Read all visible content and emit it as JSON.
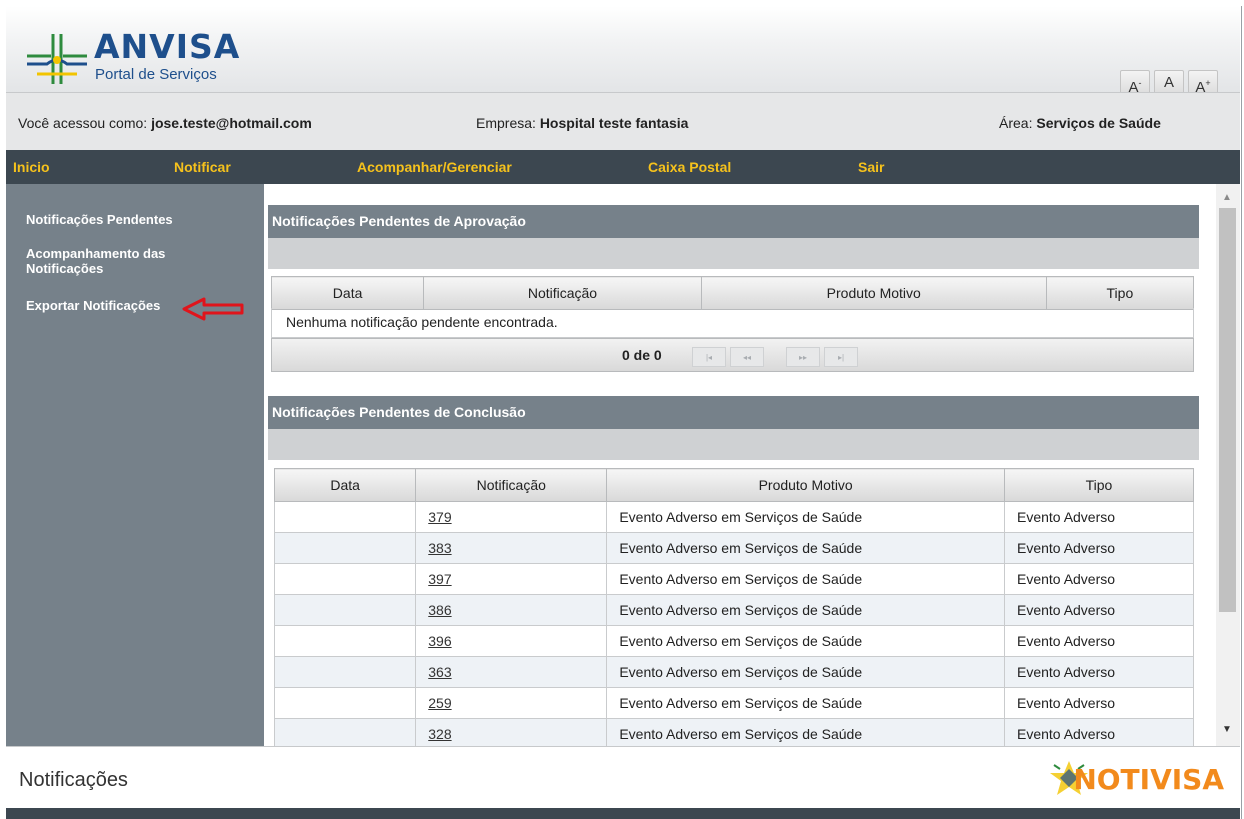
{
  "header": {
    "brand_title": "ANVISA",
    "brand_subtitle": "Portal de Serviços",
    "font_controls": [
      "A",
      "A",
      "A"
    ],
    "font_controls_sup": [
      "-",
      "",
      "+"
    ]
  },
  "user_info": {
    "user_label": "Você acessou como:",
    "user_value": "jose.teste@hotmail.com",
    "company_label": "Empresa:",
    "company_value": "Hospital teste fantasia",
    "area_label": "Área:",
    "area_value": "Serviços de Saúde"
  },
  "menu": {
    "items": [
      "Inicio",
      "Notificar",
      "Acompanhar/Gerenciar",
      "Caixa Postal",
      "Sair"
    ]
  },
  "sidebar": {
    "items": [
      "Notificações Pendentes",
      "Acompanhamento das Notificações",
      "Exportar Notificações"
    ]
  },
  "approval": {
    "title": "Notificações Pendentes de Aprovação",
    "columns": [
      "Data",
      "Notificação",
      "Produto Motivo",
      "Tipo"
    ],
    "empty_message": "Nenhuma notificação pendente encontrada.",
    "pager_count": "0 de 0",
    "pager_buttons": [
      "|◂",
      "◂◂",
      "▸▸",
      "▸|"
    ]
  },
  "conclusion": {
    "title": "Notificações Pendentes de Conclusão",
    "columns": [
      "Data",
      "Notificação",
      "Produto Motivo",
      "Tipo"
    ],
    "rows": [
      {
        "data": "",
        "notificacao": "379",
        "produto_motivo": "Evento Adverso em Serviços de Saúde",
        "tipo": "Evento Adverso"
      },
      {
        "data": "",
        "notificacao": "383",
        "produto_motivo": "Evento Adverso em Serviços de Saúde",
        "tipo": "Evento Adverso"
      },
      {
        "data": "",
        "notificacao": "397",
        "produto_motivo": "Evento Adverso em Serviços de Saúde",
        "tipo": "Evento Adverso"
      },
      {
        "data": "",
        "notificacao": "386",
        "produto_motivo": "Evento Adverso em Serviços de Saúde",
        "tipo": "Evento Adverso"
      },
      {
        "data": "",
        "notificacao": "396",
        "produto_motivo": "Evento Adverso em Serviços de Saúde",
        "tipo": "Evento Adverso"
      },
      {
        "data": "",
        "notificacao": "363",
        "produto_motivo": "Evento Adverso em Serviços de Saúde",
        "tipo": "Evento Adverso"
      },
      {
        "data": "",
        "notificacao": "259",
        "produto_motivo": "Evento Adverso em Serviços de Saúde",
        "tipo": "Evento Adverso"
      },
      {
        "data": "",
        "notificacao": "328",
        "produto_motivo": "Evento Adverso em Serviços de Saúde",
        "tipo": "Evento Adverso"
      }
    ]
  },
  "footer": {
    "title": "Notificações",
    "brand": "NOTIVISA"
  },
  "colors": {
    "menu_bg": "#3c4750",
    "menu_text": "#f6c21c",
    "sidebar_bg": "#76818a",
    "brand_blue": "#1e4f8c",
    "brand_orange": "#f28a1c",
    "annotation_arrow": "#e0141b"
  },
  "icons": {
    "logo": "anvisa-cross-logo",
    "annotation": "red-arrow-pointing-left",
    "footer_logo": "notivisa-star-icon"
  }
}
